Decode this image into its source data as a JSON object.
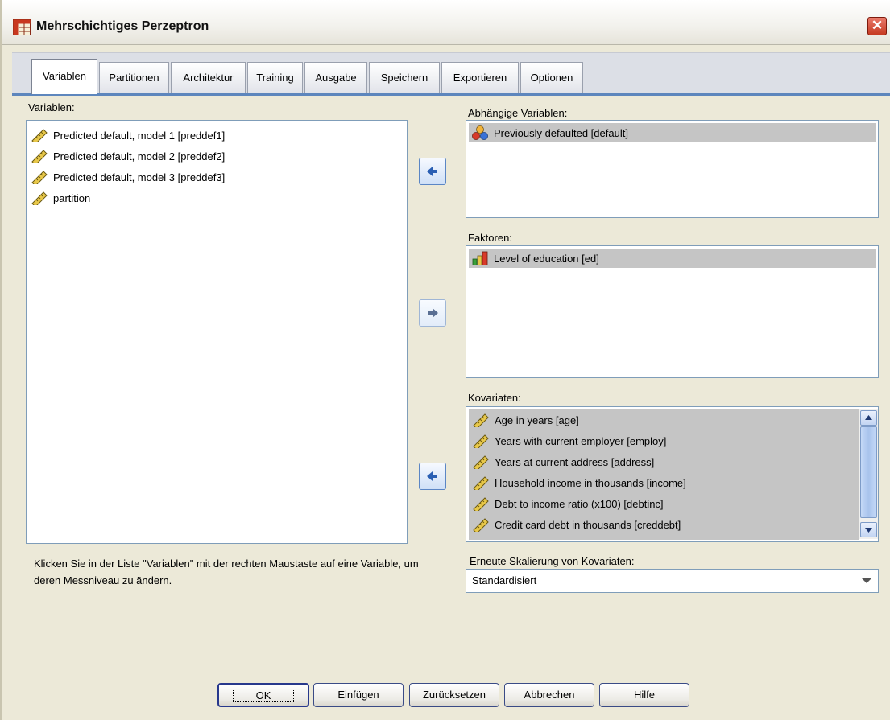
{
  "window": {
    "title": "Mehrschichtiges Perzeptron",
    "close_symbol": "✕"
  },
  "tabs": [
    {
      "label": "Variablen",
      "active": true
    },
    {
      "label": "Partitionen",
      "active": false
    },
    {
      "label": "Architektur",
      "active": false
    },
    {
      "label": "Training",
      "active": false
    },
    {
      "label": "Ausgabe",
      "active": false
    },
    {
      "label": "Speichern",
      "active": false
    },
    {
      "label": "Exportieren",
      "active": false
    },
    {
      "label": "Optionen",
      "active": false
    }
  ],
  "variables": {
    "label": "Variablen:",
    "items": [
      {
        "text": "Predicted default, model 1 [preddef1]",
        "icon": "ruler-scale-icon"
      },
      {
        "text": "Predicted default, model 2 [preddef2]",
        "icon": "ruler-scale-icon"
      },
      {
        "text": "Predicted default, model 3 [preddef3]",
        "icon": "ruler-scale-icon"
      },
      {
        "text": "partition",
        "icon": "ruler-scale-icon"
      }
    ]
  },
  "dependent": {
    "label": "Abhängige Variablen:",
    "items": [
      {
        "text": "Previously defaulted [default]",
        "icon": "nominal-circles-icon"
      }
    ]
  },
  "factors": {
    "label": "Faktoren:",
    "items": [
      {
        "text": "Level of education [ed]",
        "icon": "ordinal-bars-icon"
      }
    ]
  },
  "covariates": {
    "label": "Kovariaten:",
    "items": [
      {
        "text": "Age in years [age]",
        "icon": "ruler-scale-icon"
      },
      {
        "text": "Years with current employer [employ]",
        "icon": "ruler-scale-icon"
      },
      {
        "text": "Years at current address [address]",
        "icon": "ruler-scale-icon"
      },
      {
        "text": "Household income in thousands [income]",
        "icon": "ruler-scale-icon"
      },
      {
        "text": "Debt to income ratio (x100) [debtinc]",
        "icon": "ruler-scale-icon"
      },
      {
        "text": "Credit card debt in thousands [creddebt]",
        "icon": "ruler-scale-icon"
      }
    ]
  },
  "hint": "Klicken Sie in der Liste \"Variablen\" mit der rechten Maustaste auf eine Variable, um deren Messniveau zu ändern.",
  "rescale": {
    "label": "Erneute Skalierung von Kovariaten:",
    "value": "Standardisiert"
  },
  "buttons": {
    "ok": "OK",
    "paste": "Einfügen",
    "reset": "Zurücksetzen",
    "cancel": "Abbrechen",
    "help": "Hilfe"
  },
  "colors": {
    "accent": "#5d86bd",
    "selection": "#c5c5c5"
  }
}
